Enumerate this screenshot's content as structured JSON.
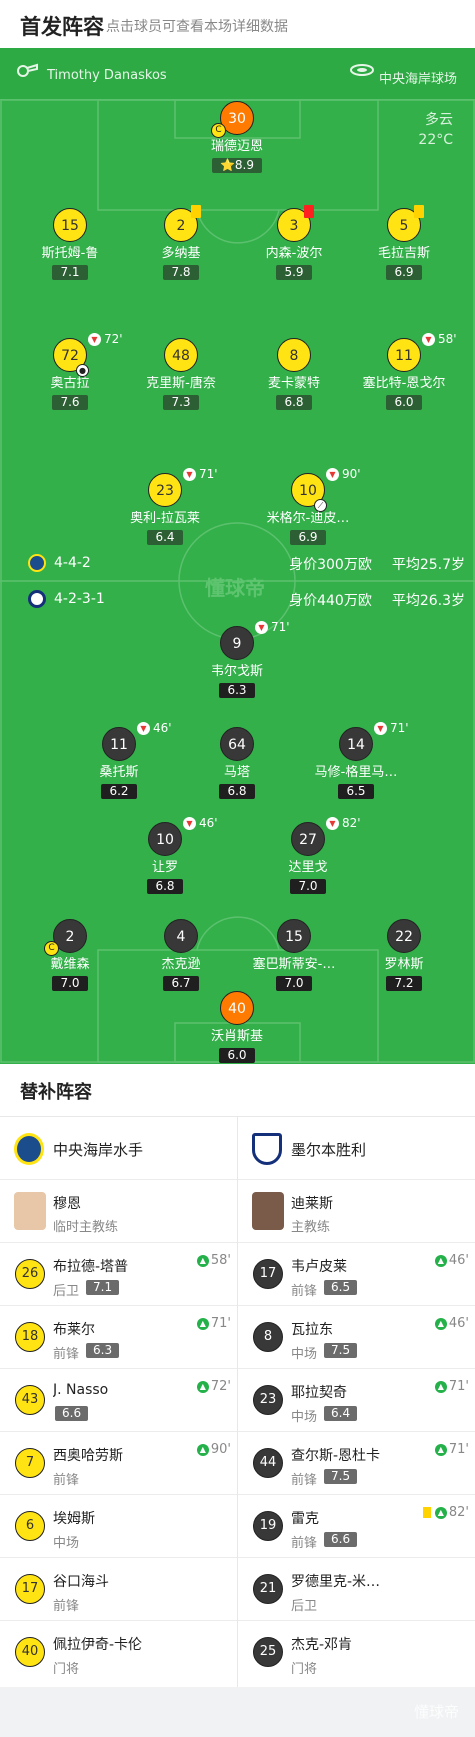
{
  "header": {
    "title": "首发阵容",
    "subtitle": "点击球员可查看本场详细数据"
  },
  "match_info": {
    "referee": "Timothy Danaskos",
    "venue": "中央海岸球场",
    "weather": "多云",
    "temperature": "22°C"
  },
  "home": {
    "formation": "4-4-2",
    "value": "身价300万欧",
    "age": "平均25.7岁",
    "logo_color": "#1b4d8c"
  },
  "away": {
    "formation": "4-2-3-1",
    "value": "身价440万欧",
    "age": "平均26.3岁",
    "logo_color": "#15307a"
  },
  "watermark": "懂球帝",
  "home_players": [
    {
      "num": "30",
      "name": "瑞德迈恩",
      "rating": "⭐8.9",
      "gk": true,
      "captain": true
    },
    {
      "num": "15",
      "name": "斯托姆-鲁",
      "rating": "7.1"
    },
    {
      "num": "2",
      "name": "多纳基",
      "rating": "7.8",
      "card": "yellow"
    },
    {
      "num": "3",
      "name": "内森-波尔",
      "rating": "5.9",
      "card": "red"
    },
    {
      "num": "5",
      "name": "毛拉吉斯",
      "rating": "6.9",
      "card": "yellow"
    },
    {
      "num": "72",
      "name": "奥古拉",
      "rating": "7.6",
      "sub": "72'",
      "goal": true
    },
    {
      "num": "48",
      "name": "克里斯-唐奈",
      "rating": "7.3"
    },
    {
      "num": "8",
      "name": "麦卡蒙特",
      "rating": "6.8"
    },
    {
      "num": "11",
      "name": "塞比特-恩戈尔",
      "rating": "6.0",
      "sub": "58'"
    },
    {
      "num": "23",
      "name": "奥利-拉瓦莱",
      "rating": "6.4",
      "sub": "71'"
    },
    {
      "num": "10",
      "name": "米格尔-迪皮…",
      "rating": "6.9",
      "sub": "90'",
      "assist": true
    }
  ],
  "away_players": [
    {
      "num": "9",
      "name": "韦尔戈斯",
      "rating": "6.3",
      "sub": "71'"
    },
    {
      "num": "11",
      "name": "桑托斯",
      "rating": "6.2",
      "sub": "46'"
    },
    {
      "num": "64",
      "name": "马塔",
      "rating": "6.8"
    },
    {
      "num": "14",
      "name": "马修-格里马…",
      "rating": "6.5",
      "sub": "71'"
    },
    {
      "num": "10",
      "name": "让罗",
      "rating": "6.8",
      "sub": "46'"
    },
    {
      "num": "27",
      "name": "达里戈",
      "rating": "7.0",
      "sub": "82'"
    },
    {
      "num": "2",
      "name": "戴维森",
      "rating": "7.0",
      "captain": true
    },
    {
      "num": "4",
      "name": "杰克逊",
      "rating": "6.7"
    },
    {
      "num": "15",
      "name": "塞巴斯蒂安-…",
      "rating": "7.0"
    },
    {
      "num": "22",
      "name": "罗林斯",
      "rating": "7.2"
    },
    {
      "num": "40",
      "name": "沃肖斯基",
      "rating": "6.0",
      "gk": true
    }
  ],
  "subs": {
    "title": "替补阵容",
    "home": {
      "team": "中央海岸水手",
      "coach": {
        "name": "穆恩",
        "role": "临时主教练"
      },
      "players": [
        {
          "num": "26",
          "name": "布拉德-塔普",
          "pos": "后卫",
          "rating": "7.1",
          "min": "58'"
        },
        {
          "num": "18",
          "name": "布莱尔",
          "pos": "前锋",
          "rating": "6.3",
          "min": "71'"
        },
        {
          "num": "43",
          "name": "J. Nasso",
          "pos": "",
          "rating": "6.6",
          "min": "72'"
        },
        {
          "num": "7",
          "name": "西奥哈劳斯",
          "pos": "前锋",
          "rating": "",
          "min": "90'"
        },
        {
          "num": "6",
          "name": "埃姆斯",
          "pos": "中场",
          "rating": "",
          "min": ""
        },
        {
          "num": "17",
          "name": "谷口海斗",
          "pos": "前锋",
          "rating": "",
          "min": ""
        },
        {
          "num": "40",
          "name": "佩拉伊奇-卡伦",
          "pos": "门将",
          "rating": "",
          "min": ""
        }
      ]
    },
    "away": {
      "team": "墨尔本胜利",
      "coach": {
        "name": "迪莱斯",
        "role": "主教练"
      },
      "players": [
        {
          "num": "17",
          "name": "韦卢皮莱",
          "pos": "前锋",
          "rating": "6.5",
          "min": "46'"
        },
        {
          "num": "8",
          "name": "瓦拉东",
          "pos": "中场",
          "rating": "7.5",
          "min": "46'"
        },
        {
          "num": "23",
          "name": "耶拉契奇",
          "pos": "中场",
          "rating": "6.4",
          "min": "71'"
        },
        {
          "num": "44",
          "name": "查尔斯-恩杜卡",
          "pos": "前锋",
          "rating": "7.5",
          "min": "71'"
        },
        {
          "num": "19",
          "name": "雷克",
          "pos": "前锋",
          "rating": "6.6",
          "min": "82'",
          "card": "yellow"
        },
        {
          "num": "21",
          "name": "罗德里克-米…",
          "pos": "后卫",
          "rating": "",
          "min": ""
        },
        {
          "num": "25",
          "name": "杰克-邓肯",
          "pos": "门将",
          "rating": "",
          "min": ""
        }
      ]
    }
  },
  "footer": {
    "watermark": "懂球帝"
  }
}
